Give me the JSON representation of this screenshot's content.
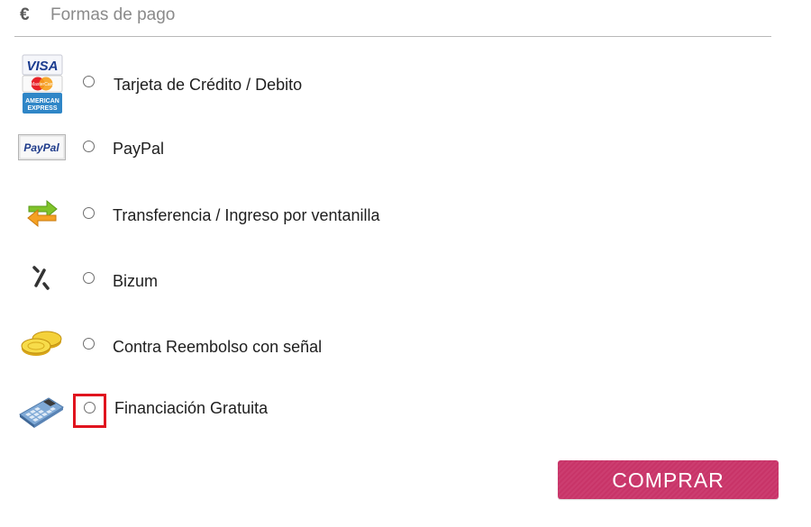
{
  "header": {
    "currency_symbol": "€",
    "title": "Formas de pago"
  },
  "payment_methods": [
    {
      "label": "Tarjeta de Crédito / Debito",
      "icon": "credit-cards-icon",
      "icon_text": [
        "VISA",
        "MasterCard",
        "AMERICAN",
        "EXPRESS"
      ],
      "selected": false
    },
    {
      "label": "PayPal",
      "icon": "paypal-icon",
      "icon_text": "PayPal",
      "selected": false
    },
    {
      "label": "Transferencia / Ingreso por ventanilla",
      "icon": "transfer-arrows-icon",
      "selected": false
    },
    {
      "label": "Bizum",
      "icon": "bizum-icon",
      "selected": false
    },
    {
      "label": "Contra Reembolso con señal",
      "icon": "coins-icon",
      "selected": false
    },
    {
      "label": "Financiación Gratuita",
      "icon": "calculator-icon",
      "selected": false,
      "highlighted": true
    }
  ],
  "buy_button": {
    "label": "COMPRAR"
  },
  "colors": {
    "button": "#cc3d70",
    "highlight": "#e0141e",
    "divider": "#b8b8b8"
  }
}
